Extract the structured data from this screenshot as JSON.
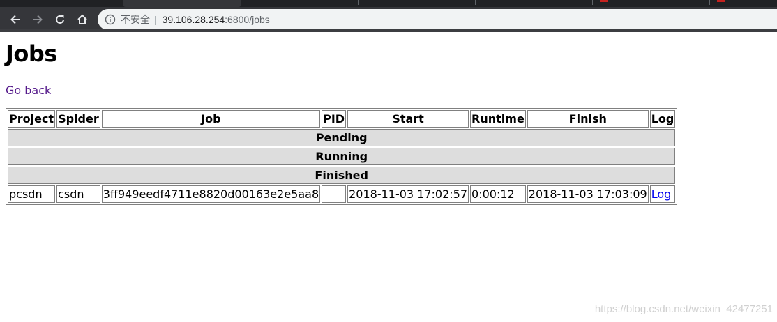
{
  "browser": {
    "security_label": "不安全",
    "url_host": "39.106.28.254",
    "url_path": ":6800/jobs"
  },
  "page": {
    "title": "Jobs",
    "back_link": "Go back"
  },
  "table": {
    "headers": [
      "Project",
      "Spider",
      "Job",
      "PID",
      "Start",
      "Runtime",
      "Finish",
      "Log"
    ],
    "sections": {
      "pending": "Pending",
      "running": "Running",
      "finished": "Finished"
    },
    "finished_rows": [
      {
        "project": "pcsdn",
        "spider": "csdn",
        "job": "3ff949eedf4711e8820d00163e2e5aa8",
        "pid": "",
        "start": "2018-11-03 17:02:57",
        "runtime": "0:00:12",
        "finish": "2018-11-03 17:03:09",
        "log": "Log"
      }
    ]
  },
  "watermark": "https://blog.csdn.net/weixin_42477251"
}
